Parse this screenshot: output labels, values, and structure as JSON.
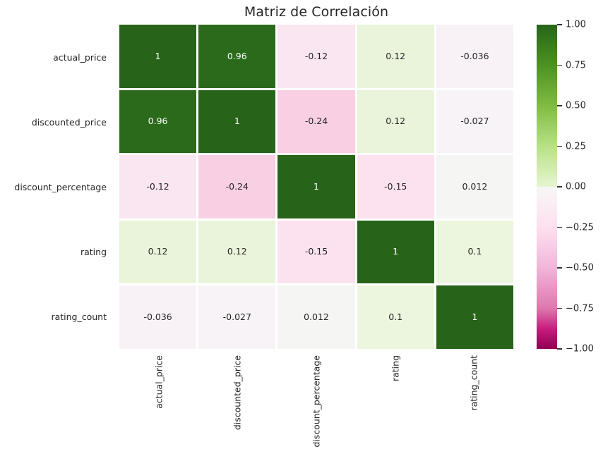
{
  "chart_data": {
    "type": "heatmap",
    "title": "Matriz de Correlación",
    "xlabel": "",
    "ylabel": "",
    "colormap": "PiYG",
    "grid": false,
    "legend_position": "right",
    "colorbar": {
      "vmin": -1.0,
      "vmax": 1.0,
      "ticks": [
        1.0,
        0.75,
        0.5,
        0.25,
        0.0,
        -0.25,
        -0.5,
        -0.75,
        -1.0
      ],
      "tick_labels": [
        "1.00",
        "0.75",
        "0.50",
        "0.25",
        "0.00",
        "−0.25",
        "−0.50",
        "−0.75",
        "−1.00"
      ]
    },
    "categories": [
      "actual_price",
      "discounted_price",
      "discount_percentage",
      "rating",
      "rating_count"
    ],
    "x_categories": [
      "actual_price",
      "discounted_price",
      "discount_percentage",
      "rating",
      "rating_count"
    ],
    "y_categories": [
      "actual_price",
      "discounted_price",
      "discount_percentage",
      "rating",
      "rating_count"
    ],
    "values": [
      [
        1,
        0.96,
        -0.12,
        0.12,
        -0.036
      ],
      [
        0.96,
        1,
        -0.24,
        0.12,
        -0.027
      ],
      [
        -0.12,
        -0.24,
        1,
        -0.15,
        0.012
      ],
      [
        0.12,
        0.12,
        -0.15,
        1,
        0.1
      ],
      [
        -0.036,
        -0.027,
        0.012,
        0.1,
        1
      ]
    ],
    "annotations": [
      [
        "1",
        "0.96",
        "-0.12",
        "0.12",
        "-0.036"
      ],
      [
        "0.96",
        "1",
        "-0.24",
        "0.12",
        "-0.027"
      ],
      [
        "-0.12",
        "-0.24",
        "1",
        "-0.15",
        "0.012"
      ],
      [
        "0.12",
        "0.12",
        "-0.15",
        "1",
        "0.1"
      ],
      [
        "-0.036",
        "-0.027",
        "0.012",
        "0.1",
        "1"
      ]
    ],
    "cell_colors": [
      [
        "#276419",
        "#2b6a1b",
        "#fae6f0",
        "#e9f4da",
        "#f8f2f6"
      ],
      [
        "#2b6a1b",
        "#276419",
        "#f9cfe4",
        "#e9f4da",
        "#f8f3f6"
      ],
      [
        "#fae6f0",
        "#f9cfe4",
        "#276419",
        "#fbe2ee",
        "#f5f5f4"
      ],
      [
        "#e9f4da",
        "#e9f4da",
        "#fbe2ee",
        "#276419",
        "#ecf5de"
      ],
      [
        "#f8f2f6",
        "#f8f3f6",
        "#f5f5f4",
        "#ecf5de",
        "#276419"
      ]
    ],
    "text_colors": [
      [
        "#ffffff",
        "#ffffff",
        "#262626",
        "#262626",
        "#262626"
      ],
      [
        "#ffffff",
        "#ffffff",
        "#262626",
        "#262626",
        "#262626"
      ],
      [
        "#262626",
        "#262626",
        "#ffffff",
        "#262626",
        "#262626"
      ],
      [
        "#262626",
        "#262626",
        "#262626",
        "#ffffff",
        "#262626"
      ],
      [
        "#262626",
        "#262626",
        "#262626",
        "#262626",
        "#ffffff"
      ]
    ]
  }
}
